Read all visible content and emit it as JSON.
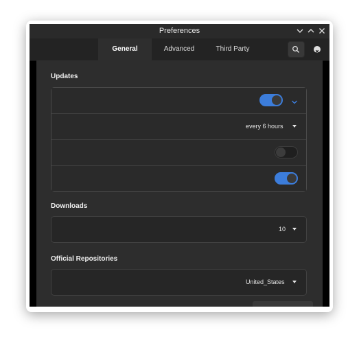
{
  "window": {
    "title": "Preferences"
  },
  "tabs": [
    {
      "label": "General",
      "active": true
    },
    {
      "label": "Advanced",
      "active": false
    },
    {
      "label": "Third Party",
      "active": false
    }
  ],
  "icons": {
    "search": "search-icon",
    "close": "close-icon",
    "minimize": "chevron-down-icon",
    "maximize": "chevron-up-icon",
    "window_close": "x-icon",
    "expander": "chevron-down-icon"
  },
  "colors": {
    "accent": "#3c7ddb",
    "window_bg": "#2d2d2d",
    "header_bg": "#232323"
  },
  "sections": {
    "updates": {
      "title": "Updates",
      "rows": [
        {
          "type": "switch",
          "on": true,
          "has_expander": true
        },
        {
          "type": "dropdown",
          "value": "every 6 hours"
        },
        {
          "type": "switch",
          "on": false
        },
        {
          "type": "switch",
          "on": true
        }
      ]
    },
    "downloads": {
      "title": "Downloads",
      "value": "10"
    },
    "official_repositories": {
      "title": "Official Repositories",
      "value": "United_States"
    }
  }
}
